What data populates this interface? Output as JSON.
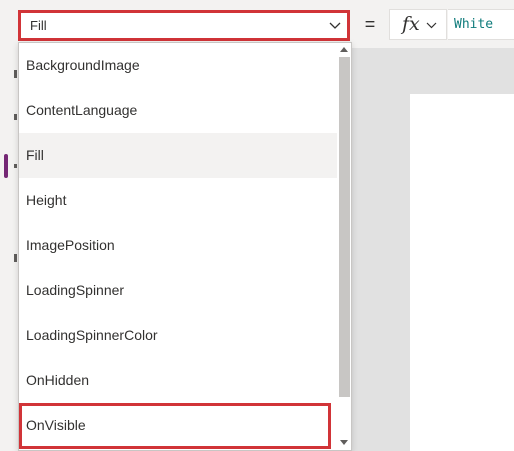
{
  "formula_bar": {
    "property_value": "Fill",
    "equals": "=",
    "fx_label": "fx",
    "formula": "White"
  },
  "dropdown": {
    "items": [
      {
        "label": "BackgroundImage"
      },
      {
        "label": "ContentLanguage"
      },
      {
        "label": "Fill"
      },
      {
        "label": "Height"
      },
      {
        "label": "ImagePosition"
      },
      {
        "label": "LoadingSpinner"
      },
      {
        "label": "LoadingSpinnerColor"
      },
      {
        "label": "OnHidden"
      },
      {
        "label": "OnVisible"
      }
    ],
    "selected": "Fill",
    "highlighted": "OnVisible"
  },
  "colors": {
    "highlight_border": "#d13438",
    "formula_text": "#107c7c",
    "nav_accent": "#742774"
  },
  "icons": [
    "chevron-down-icon",
    "fx-icon",
    "scroll-up-icon",
    "scroll-down-icon"
  ]
}
